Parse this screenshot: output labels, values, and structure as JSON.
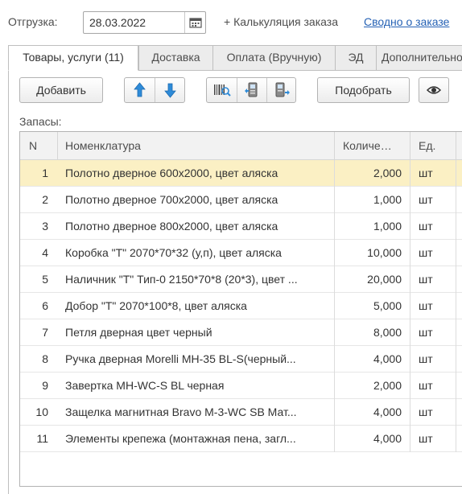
{
  "header": {
    "shipment_label": "Отгрузка:",
    "shipment_date": "28.03.2022",
    "calc_link": "+ Калькуляция заказа",
    "summary_link": "Сводно о заказе"
  },
  "tabs": [
    {
      "label": "Товары, услуги (11)",
      "active": true
    },
    {
      "label": "Доставка",
      "active": false
    },
    {
      "label": "Оплата (Вручную)",
      "active": false
    },
    {
      "label": "ЭД",
      "active": false
    },
    {
      "label": "Дополнительно",
      "active": false
    }
  ],
  "toolbar": {
    "add_label": "Добавить",
    "pick_label": "Подобрать",
    "icons": [
      "arrow-up-icon",
      "arrow-down-icon",
      "barcode-scan-icon",
      "scanner-device-icon",
      "scanner-settings-icon",
      "eye-icon"
    ]
  },
  "section_label": "Запасы:",
  "table": {
    "columns": [
      "N",
      "Номенклатура",
      "Количе…",
      "Ед."
    ],
    "rows": [
      {
        "n": "1",
        "name": "Полотно дверное 600x2000, цвет аляска",
        "qty": "2,000",
        "unit": "шт",
        "selected": true
      },
      {
        "n": "2",
        "name": "Полотно дверное 700x2000, цвет аляска",
        "qty": "1,000",
        "unit": "шт"
      },
      {
        "n": "3",
        "name": "Полотно дверное 800x2000, цвет аляска",
        "qty": "1,000",
        "unit": "шт"
      },
      {
        "n": "4",
        "name": "Коробка \"Т\" 2070*70*32 (у,п), цвет аляска",
        "qty": "10,000",
        "unit": "шт"
      },
      {
        "n": "5",
        "name": "Наличник \"Т\" Тип-0 2150*70*8 (20*3), цвет ...",
        "qty": "20,000",
        "unit": "шт"
      },
      {
        "n": "6",
        "name": "Добор \"Т\" 2070*100*8, цвет аляска",
        "qty": "5,000",
        "unit": "шт"
      },
      {
        "n": "7",
        "name": "Петля дверная цвет черный",
        "qty": "8,000",
        "unit": "шт"
      },
      {
        "n": "8",
        "name": "Ручка дверная Morelli MH-35 BL-S(черный...",
        "qty": "4,000",
        "unit": "шт"
      },
      {
        "n": "9",
        "name": "Завертка MH-WC-S BL черная",
        "qty": "2,000",
        "unit": "шт"
      },
      {
        "n": "10",
        "name": "Защелка магнитная Bravo M-3-WC SB Мат...",
        "qty": "4,000",
        "unit": "шт"
      },
      {
        "n": "11",
        "name": "Элементы крепежа (монтажная пена, загл...",
        "qty": "4,000",
        "unit": "шт"
      }
    ]
  },
  "colors": {
    "link": "#2662b5",
    "selected_row": "#fbf0c4",
    "arrow_blue": "#2e8bd8"
  }
}
